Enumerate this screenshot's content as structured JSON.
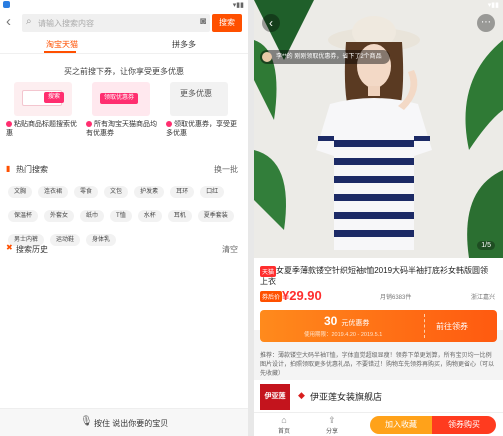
{
  "left": {
    "search": {
      "placeholder": "请输入搜索内容",
      "button": "搜索"
    },
    "tabs": [
      {
        "label": "淘宝天猫"
      },
      {
        "label": "拼多多"
      }
    ],
    "tip": "买之前搜下券，让你享受更多优惠",
    "feature_cards": [
      {
        "pill": "搜索",
        "text": "粘贴商品标题搜索优惠"
      },
      {
        "pill": "领取优惠券",
        "text": "所有淘宝天猫商品均有优惠券"
      },
      {
        "card_text": "更多优惠",
        "text": "领取优惠券，享受更多优惠"
      }
    ],
    "hot": {
      "title": "热门搜索",
      "refresh": "换一批"
    },
    "hot_tags": [
      "文胸",
      "连衣裙",
      "零食",
      "文包",
      "护发素",
      "耳环",
      "口红",
      "保温杯",
      "外套女",
      "纸巾",
      "T恤",
      "水杯",
      "耳机",
      "夏季套装",
      "男士内裤",
      "运动鞋",
      "身体乳"
    ],
    "history": {
      "title": "搜索历史",
      "clear": "清空"
    },
    "voice": "按住 说出你要的宝贝"
  },
  "right": {
    "notice": "李**的 刚刚领取优惠券，省下了2个商品",
    "page_indicator": "1/5",
    "badge": "天猫",
    "product_title": "女夏季薄款镂空针织短袖t恤2019大码半袖打底衫女韩版圆领上衣",
    "share": "分享",
    "price_tag": "券后价",
    "price": "¥29.90",
    "sales": "月销6383件",
    "shipping": "浙江嘉兴",
    "coupon": {
      "amount": "30",
      "unit": "元优惠券",
      "period": "使用期限：2019.4.20 - 2019.5.1",
      "action": "前往领券"
    },
    "description": "推荐：薄款镂空大码半袖T恤，字体直觉超级显瘦！领券下单更划算，所有宝贝均一比例图片设计，拍照领取更多优惠礼品，不要错过！购物车先领券再购买，购物更省心（可以先收藏）",
    "shop": {
      "logo": "伊亚莲",
      "name": "伊亚莲女装旗舰店"
    },
    "bottom": {
      "home": "首页",
      "share": "分享",
      "join": "加入收藏",
      "buy": "领券购买"
    }
  },
  "colors": {
    "accent": "#ff5000",
    "coupon": "#ff7a18",
    "price": "#ff2e2e"
  }
}
